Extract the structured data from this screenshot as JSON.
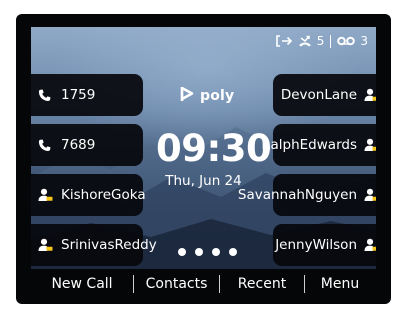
{
  "status": {
    "icons": [
      "call-forward-icon",
      "missed-call-icon",
      "voicemail-icon"
    ],
    "missed_calls": "5",
    "voicemail": "3"
  },
  "left_keys": [
    {
      "icon": "phone-icon",
      "line1": "1759",
      "line2": ""
    },
    {
      "icon": "phone-icon",
      "line1": "7689",
      "line2": ""
    },
    {
      "icon": "contact-icon",
      "line1": "Kishore",
      "line2": "Goka"
    },
    {
      "icon": "contact-icon",
      "line1": "Srinivas",
      "line2": "Reddy"
    }
  ],
  "right_keys": [
    {
      "icon": "contact-icon",
      "line1": "Devon",
      "line2": "Lane"
    },
    {
      "icon": "contact-icon",
      "line1": "Ralph",
      "line2": "Edwards"
    },
    {
      "icon": "contact-icon",
      "line1": "Savannah",
      "line2": "Nguyen"
    },
    {
      "icon": "contact-icon",
      "line1": "Jenny",
      "line2": "Wilson"
    }
  ],
  "logo": "poly",
  "time": "09:30",
  "date": "Thu, Jun 24",
  "page_dots": 4,
  "softkeys": [
    "New Call",
    "Contacts",
    "Recent",
    "Menu"
  ],
  "colors": {
    "accent_contact": "#f5c518",
    "tile_bg": "#06080c"
  }
}
